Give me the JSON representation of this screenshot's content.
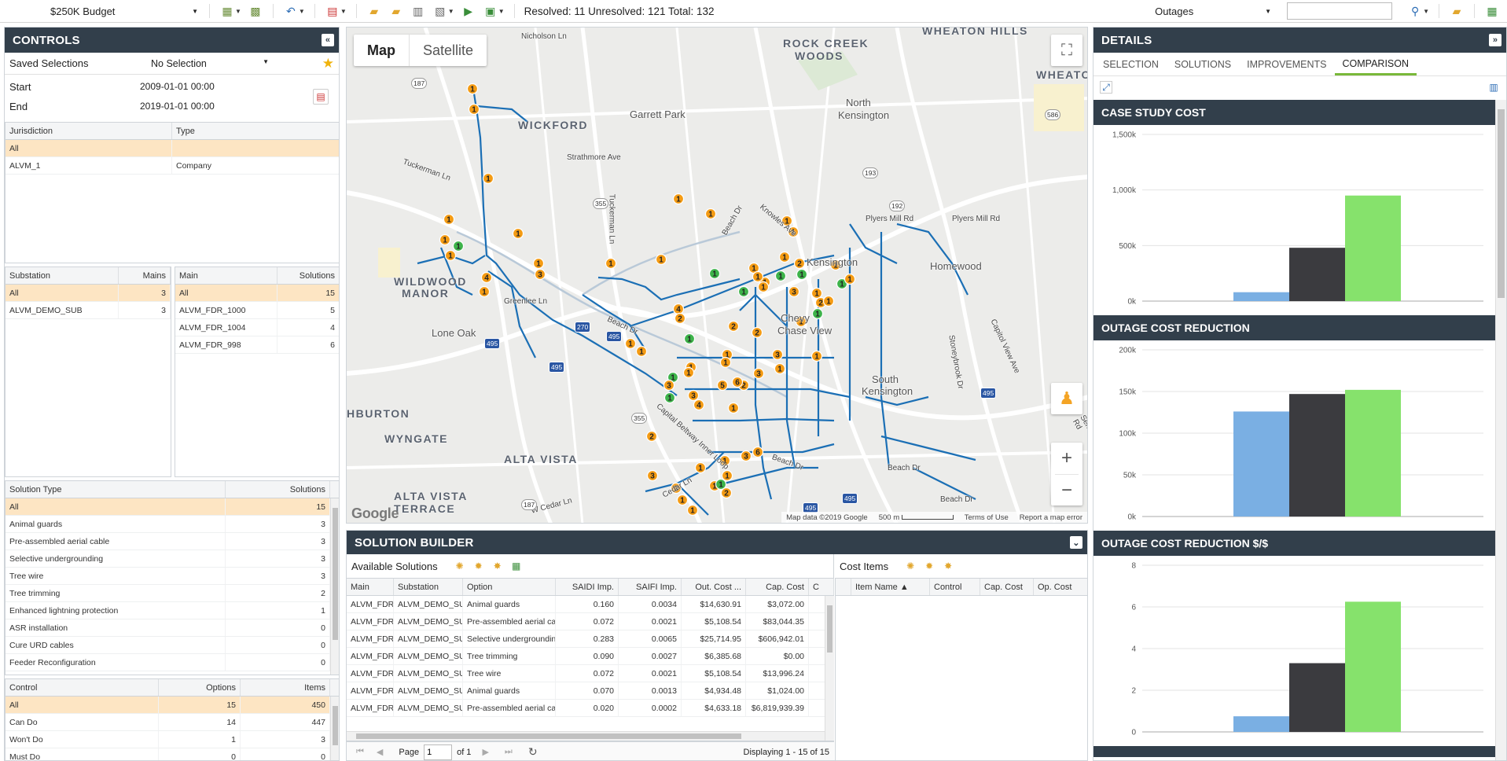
{
  "toolbar": {
    "budget_select": "$250K Budget",
    "status_text": "Resolved: 11 Unresolved: 121 Total: 132",
    "layer_select": "Outages",
    "search_placeholder": ""
  },
  "controls": {
    "title": "CONTROLS",
    "saved_label": "Saved Selections",
    "saved_value": "No Selection",
    "start_label": "Start",
    "start_value": "2009-01-01 00:00",
    "end_label": "End",
    "end_value": "2019-01-01 00:00",
    "jurisdiction": {
      "headers": [
        "Jurisdiction",
        "Type"
      ],
      "rows": [
        [
          "All",
          ""
        ],
        [
          "ALVM_1",
          "Company"
        ]
      ]
    },
    "substation": {
      "headers": [
        "Substation",
        "Mains"
      ],
      "rows": [
        [
          "All",
          "3"
        ],
        [
          "ALVM_DEMO_SUB",
          "3"
        ]
      ]
    },
    "main": {
      "headers": [
        "Main",
        "Solutions"
      ],
      "rows": [
        [
          "All",
          "15"
        ],
        [
          "ALVM_FDR_1000",
          "5"
        ],
        [
          "ALVM_FDR_1004",
          "4"
        ],
        [
          "ALVM_FDR_998",
          "6"
        ]
      ]
    },
    "solution_type": {
      "headers": [
        "Solution Type",
        "Solutions"
      ],
      "rows": [
        [
          "All",
          "15"
        ],
        [
          "Animal guards",
          "3"
        ],
        [
          "Pre-assembled aerial cable",
          "3"
        ],
        [
          "Selective undergrounding",
          "3"
        ],
        [
          "Tree wire",
          "3"
        ],
        [
          "Tree trimming",
          "2"
        ],
        [
          "Enhanced lightning protection",
          "1"
        ],
        [
          "ASR installation",
          "0"
        ],
        [
          "Cure URD cables",
          "0"
        ],
        [
          "Feeder Reconfiguration",
          "0"
        ]
      ]
    },
    "control": {
      "headers": [
        "Control",
        "Options",
        "Items"
      ],
      "rows": [
        [
          "All",
          "15",
          "450"
        ],
        [
          "Can Do",
          "14",
          "447"
        ],
        [
          "Won't Do",
          "1",
          "3"
        ],
        [
          "Must Do",
          "0",
          "0"
        ]
      ]
    }
  },
  "map": {
    "tab_map": "Map",
    "tab_satellite": "Satellite",
    "zoom_in": "+",
    "zoom_out": "−",
    "logo": "Google",
    "attribution": "Map data ©2019 Google",
    "scale": "500 m",
    "terms": "Terms of Use",
    "report": "Report a map error",
    "areas": [
      {
        "name": "ROCK CREEK",
        "name2": "WOODS"
      },
      {
        "name": "WHEATON HILLS"
      },
      {
        "name": "WHEATO"
      },
      {
        "name": "WICKFORD"
      },
      {
        "name": "WILDWOOD",
        "name2": "MANOR"
      },
      {
        "name": "HBURTON"
      },
      {
        "name": "WYNGATE"
      },
      {
        "name": "ALTA VISTA"
      },
      {
        "name": "ALTA VISTA",
        "name2": "TERRACE"
      }
    ],
    "towns": [
      "Garrett Park",
      "North",
      "Kensington",
      "Kensington",
      "Homewood",
      "Lone Oak",
      "Chevy",
      "Chase View",
      "South",
      "Kensington"
    ],
    "streets": [
      "Nicholson Ln",
      "Strathmore Ave",
      "Tuckerman Ln",
      "Tuckerman Ln",
      "Knowles Ave",
      "Beach Dr",
      "Plyers Mill Rd",
      "Plyers Mill Rd",
      "Greenlee Ln",
      "Beach Dr",
      "Capital Beltway Inner Loop",
      "Beach Dr",
      "Beach Dr",
      "Capitol View Ave",
      "Stoneybrook Dr",
      "Cedar Ln",
      "W Cedar Ln",
      "Beach Dr",
      "Seminary Rd"
    ],
    "shields": [
      "187",
      "355",
      "586",
      "193",
      "192",
      "270",
      "495",
      "495",
      "495",
      "495",
      "355",
      "187",
      "495",
      "495"
    ],
    "markers": [
      {
        "n": "1",
        "c": "o"
      },
      {
        "n": "1",
        "c": "o"
      },
      {
        "n": "1",
        "c": "o"
      },
      {
        "n": "1",
        "c": "o"
      },
      {
        "n": "1",
        "c": "o"
      },
      {
        "n": "1",
        "c": "g"
      },
      {
        "n": "1",
        "c": "o"
      },
      {
        "n": "1",
        "c": "o"
      },
      {
        "n": "4",
        "c": "o"
      },
      {
        "n": "1",
        "c": "o"
      },
      {
        "n": "1",
        "c": "o"
      },
      {
        "n": "3",
        "c": "o"
      },
      {
        "n": "1",
        "c": "o"
      },
      {
        "n": "1",
        "c": "o"
      },
      {
        "n": "1",
        "c": "o"
      },
      {
        "n": "1",
        "c": "o"
      },
      {
        "n": "1",
        "c": "o"
      },
      {
        "n": "1",
        "c": "o"
      },
      {
        "n": "1",
        "c": "o"
      },
      {
        "n": "1",
        "c": "g"
      },
      {
        "n": "1",
        "c": "g"
      },
      {
        "n": "2",
        "c": "o"
      },
      {
        "n": "1",
        "c": "g"
      },
      {
        "n": "1",
        "c": "o"
      },
      {
        "n": "1",
        "c": "o"
      },
      {
        "n": "1",
        "c": "o"
      },
      {
        "n": "1",
        "c": "g"
      },
      {
        "n": "4",
        "c": "o"
      },
      {
        "n": "1",
        "c": "g"
      },
      {
        "n": "1",
        "c": "o"
      },
      {
        "n": "1",
        "c": "o"
      },
      {
        "n": "2",
        "c": "o"
      },
      {
        "n": "1",
        "c": "o"
      },
      {
        "n": "1",
        "c": "o"
      },
      {
        "n": "2",
        "c": "o"
      },
      {
        "n": "1",
        "c": "o"
      },
      {
        "n": "2",
        "c": "o"
      },
      {
        "n": "1",
        "c": "o"
      },
      {
        "n": "1",
        "c": "g"
      },
      {
        "n": "1",
        "c": "o"
      },
      {
        "n": "3",
        "c": "o"
      },
      {
        "n": "5",
        "c": "o"
      },
      {
        "n": "2",
        "c": "o"
      },
      {
        "n": "3",
        "c": "o"
      },
      {
        "n": "1",
        "c": "g"
      },
      {
        "n": "1",
        "c": "o"
      },
      {
        "n": "4",
        "c": "o"
      },
      {
        "n": "1",
        "c": "o"
      },
      {
        "n": "6",
        "c": "o"
      },
      {
        "n": "3",
        "c": "o"
      },
      {
        "n": "1",
        "c": "o"
      },
      {
        "n": "1",
        "c": "o"
      },
      {
        "n": "3",
        "c": "o"
      },
      {
        "n": "2",
        "c": "o"
      },
      {
        "n": "1",
        "c": "o"
      },
      {
        "n": "1",
        "c": "o"
      },
      {
        "n": "3",
        "c": "o"
      },
      {
        "n": "3",
        "c": "o"
      },
      {
        "n": "6",
        "c": "o"
      },
      {
        "n": "3",
        "c": "o"
      },
      {
        "n": "1",
        "c": "o"
      },
      {
        "n": "1",
        "c": "g"
      },
      {
        "n": "1",
        "c": "o"
      },
      {
        "n": "1",
        "c": "o"
      },
      {
        "n": "1",
        "c": "o"
      },
      {
        "n": "2",
        "c": "o"
      },
      {
        "n": "1",
        "c": "o"
      },
      {
        "n": "1",
        "c": "o"
      },
      {
        "n": "1",
        "c": "g"
      },
      {
        "n": "1",
        "c": "o"
      },
      {
        "n": "3",
        "c": "o"
      },
      {
        "n": "2",
        "c": "o"
      },
      {
        "n": "1",
        "c": "g"
      },
      {
        "n": "1",
        "c": "o"
      }
    ]
  },
  "builder": {
    "title": "SOLUTION BUILDER",
    "available_title": "Available Solutions",
    "cost_title": "Cost Items",
    "available_headers": [
      "Main",
      "Substation",
      "Option",
      "SAIDI Imp.",
      "SAIFI Imp.",
      "Out. Cost ...",
      "Cap. Cost",
      "C"
    ],
    "available_rows": [
      [
        "ALVM_FDR_",
        "ALVM_DEMO_SUB",
        "Animal guards",
        "0.160",
        "0.0034",
        "$14,630.91",
        "$3,072.00"
      ],
      [
        "ALVM_FDR_",
        "ALVM_DEMO_SUB",
        "Pre-assembled aerial cab",
        "0.072",
        "0.0021",
        "$5,108.54",
        "$83,044.35"
      ],
      [
        "ALVM_FDR_",
        "ALVM_DEMO_SUB",
        "Selective undergroundin",
        "0.283",
        "0.0065",
        "$25,714.95",
        "$606,942.01"
      ],
      [
        "ALVM_FDR_",
        "ALVM_DEMO_SUB",
        "Tree trimming",
        "0.090",
        "0.0027",
        "$6,385.68",
        "$0.00"
      ],
      [
        "ALVM_FDR_",
        "ALVM_DEMO_SUB",
        "Tree wire",
        "0.072",
        "0.0021",
        "$5,108.54",
        "$13,996.24"
      ],
      [
        "ALVM_FDR_",
        "ALVM_DEMO_SUB",
        "Animal guards",
        "0.070",
        "0.0013",
        "$4,934.48",
        "$1,024.00"
      ],
      [
        "ALVM_FDR_",
        "ALVM_DEMO_SUB",
        "Pre-assembled aerial cab",
        "0.020",
        "0.0002",
        "$4,633.18",
        "$6,819,939.39"
      ]
    ],
    "cost_headers": [
      "Item Name ▲",
      "Control",
      "Cap. Cost",
      "Op. Cost"
    ],
    "pager": {
      "page_label": "Page",
      "page_value": "1",
      "of_label": "of 1",
      "displaying": "Displaying 1 - 15 of 15"
    }
  },
  "details": {
    "title": "DETAILS",
    "tabs": [
      "SELECTION",
      "SOLUTIONS",
      "IMPROVEMENTS",
      "COMPARISON"
    ],
    "active_tab": "COMPARISON"
  },
  "chart_data": [
    {
      "type": "bar",
      "title": "CASE STUDY COST",
      "categories": [
        "",
        "",
        ""
      ],
      "values": [
        80000,
        480000,
        950000
      ],
      "colors": [
        "#7aafe3",
        "#3b3b3f",
        "#86e26c"
      ],
      "yticks": [
        "0k",
        "500k",
        "1,000k",
        "1,500k"
      ],
      "ylim": [
        0,
        1500000
      ]
    },
    {
      "type": "bar",
      "title": "OUTAGE COST REDUCTION",
      "categories": [
        "",
        "",
        ""
      ],
      "values": [
        126000,
        147000,
        152000
      ],
      "colors": [
        "#7aafe3",
        "#3b3b3f",
        "#86e26c"
      ],
      "yticks": [
        "0k",
        "50k",
        "100k",
        "150k",
        "200k"
      ],
      "ylim": [
        0,
        200000
      ]
    },
    {
      "type": "bar",
      "title": "OUTAGE COST REDUCTION $/$",
      "categories": [
        "",
        "",
        ""
      ],
      "values": [
        0.75,
        3.3,
        6.25
      ],
      "colors": [
        "#7aafe3",
        "#3b3b3f",
        "#86e26c"
      ],
      "yticks": [
        "0",
        "2",
        "4",
        "6",
        "8"
      ],
      "ylim": [
        0,
        8
      ]
    }
  ]
}
